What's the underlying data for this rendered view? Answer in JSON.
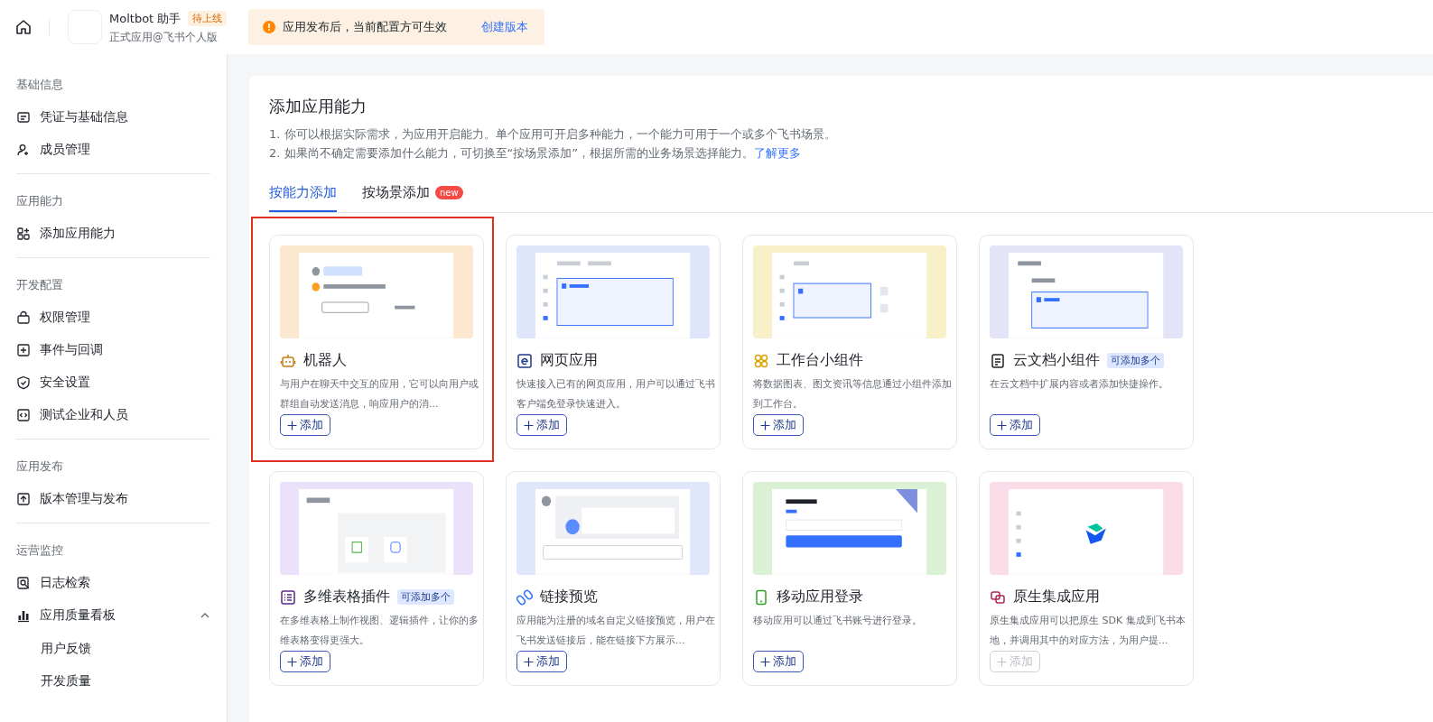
{
  "top_bar": {
    "app_name": "Moltbot 助手",
    "app_status": "待上线",
    "app_edition": "正式应用@飞书个人版",
    "notice": {
      "text": "应用发布后，当前配置方可生效",
      "action": "创建版本"
    }
  },
  "sidebar": {
    "groups": [
      {
        "title": "基础信息",
        "items": [
          {
            "label": "凭证与基础信息"
          },
          {
            "label": "成员管理"
          }
        ]
      },
      {
        "title": "应用能力",
        "items": [
          {
            "label": "添加应用能力"
          }
        ]
      },
      {
        "title": "开发配置",
        "items": [
          {
            "label": "权限管理"
          },
          {
            "label": "事件与回调"
          },
          {
            "label": "安全设置"
          },
          {
            "label": "测试企业和人员"
          }
        ]
      },
      {
        "title": "应用发布",
        "items": [
          {
            "label": "版本管理与发布"
          }
        ]
      },
      {
        "title": "运营监控",
        "items": [
          {
            "label": "日志检索"
          },
          {
            "label": "应用质量看板",
            "expanded": true,
            "children": [
              {
                "label": "用户反馈"
              },
              {
                "label": "开发质量"
              }
            ]
          }
        ]
      }
    ]
  },
  "main": {
    "title": "添加应用能力",
    "notes": [
      "1. 你可以根据实际需求，为应用开启能力。单个应用可开启多种能力，一个能力可用于一个或多个飞书场景。",
      "2. 如果尚不确定需要添加什么能力，可切换至“按场景添加”，根据所需的业务场景选择能力。"
    ],
    "learn_more": "了解更多",
    "tabs": [
      {
        "label": "按能力添加",
        "selected": true
      },
      {
        "label": "按场景添加",
        "selected": false,
        "badge": "new"
      }
    ],
    "cards": [
      {
        "kind": "robot",
        "title": "机器人",
        "color": "#fbe8cf",
        "highlighted": true,
        "description": "与用户在聊天中交互的应用，它可以向用户或群组自动发送消息，响应用户的消...",
        "button": "添加",
        "disabled": false
      },
      {
        "kind": "web",
        "title": "网页应用",
        "color": "#dfe6fb",
        "highlighted": false,
        "description": "快速接入已有的网页应用，用户可以通过飞书客户端免登录快速进入。",
        "button": "添加",
        "disabled": false
      },
      {
        "kind": "widget",
        "title": "工作台小组件",
        "color": "#f8f0c8",
        "highlighted": false,
        "description": "将数据图表、图文资讯等信息通过小组件添加到工作台。",
        "button": "添加",
        "disabled": false
      },
      {
        "kind": "doc",
        "title": "云文档小组件",
        "badge": "可添加多个",
        "color": "#e4e4f8",
        "highlighted": false,
        "description": "在云文档中扩展内容或者添加快捷操作。",
        "button": "添加",
        "disabled": false
      },
      {
        "kind": "table",
        "title": "多维表格插件",
        "badge": "可添加多个",
        "color": "#ece1fa",
        "highlighted": false,
        "description": "在多维表格上制作视图、逻辑插件，让你的多维表格变得更强大。",
        "button": "添加",
        "disabled": false
      },
      {
        "kind": "link",
        "title": "链接预览",
        "color": "#e0e7fb",
        "highlighted": false,
        "description": "应用能为注册的域名自定义链接预览，用户在飞书发送链接后，能在链接下方展示...",
        "button": "添加",
        "disabled": false
      },
      {
        "kind": "mobile",
        "title": "移动应用登录",
        "color": "#daf1d5",
        "highlighted": false,
        "description": "移动应用可以通过飞书账号进行登录。",
        "button": "添加",
        "disabled": false
      },
      {
        "kind": "native",
        "title": "原生集成应用",
        "color": "#fadde8",
        "highlighted": false,
        "description": "原生集成应用可以把原生 SDK 集成到飞书本地，并调用其中的对应方法，为用户提...",
        "button": "添加",
        "disabled": true
      }
    ]
  }
}
